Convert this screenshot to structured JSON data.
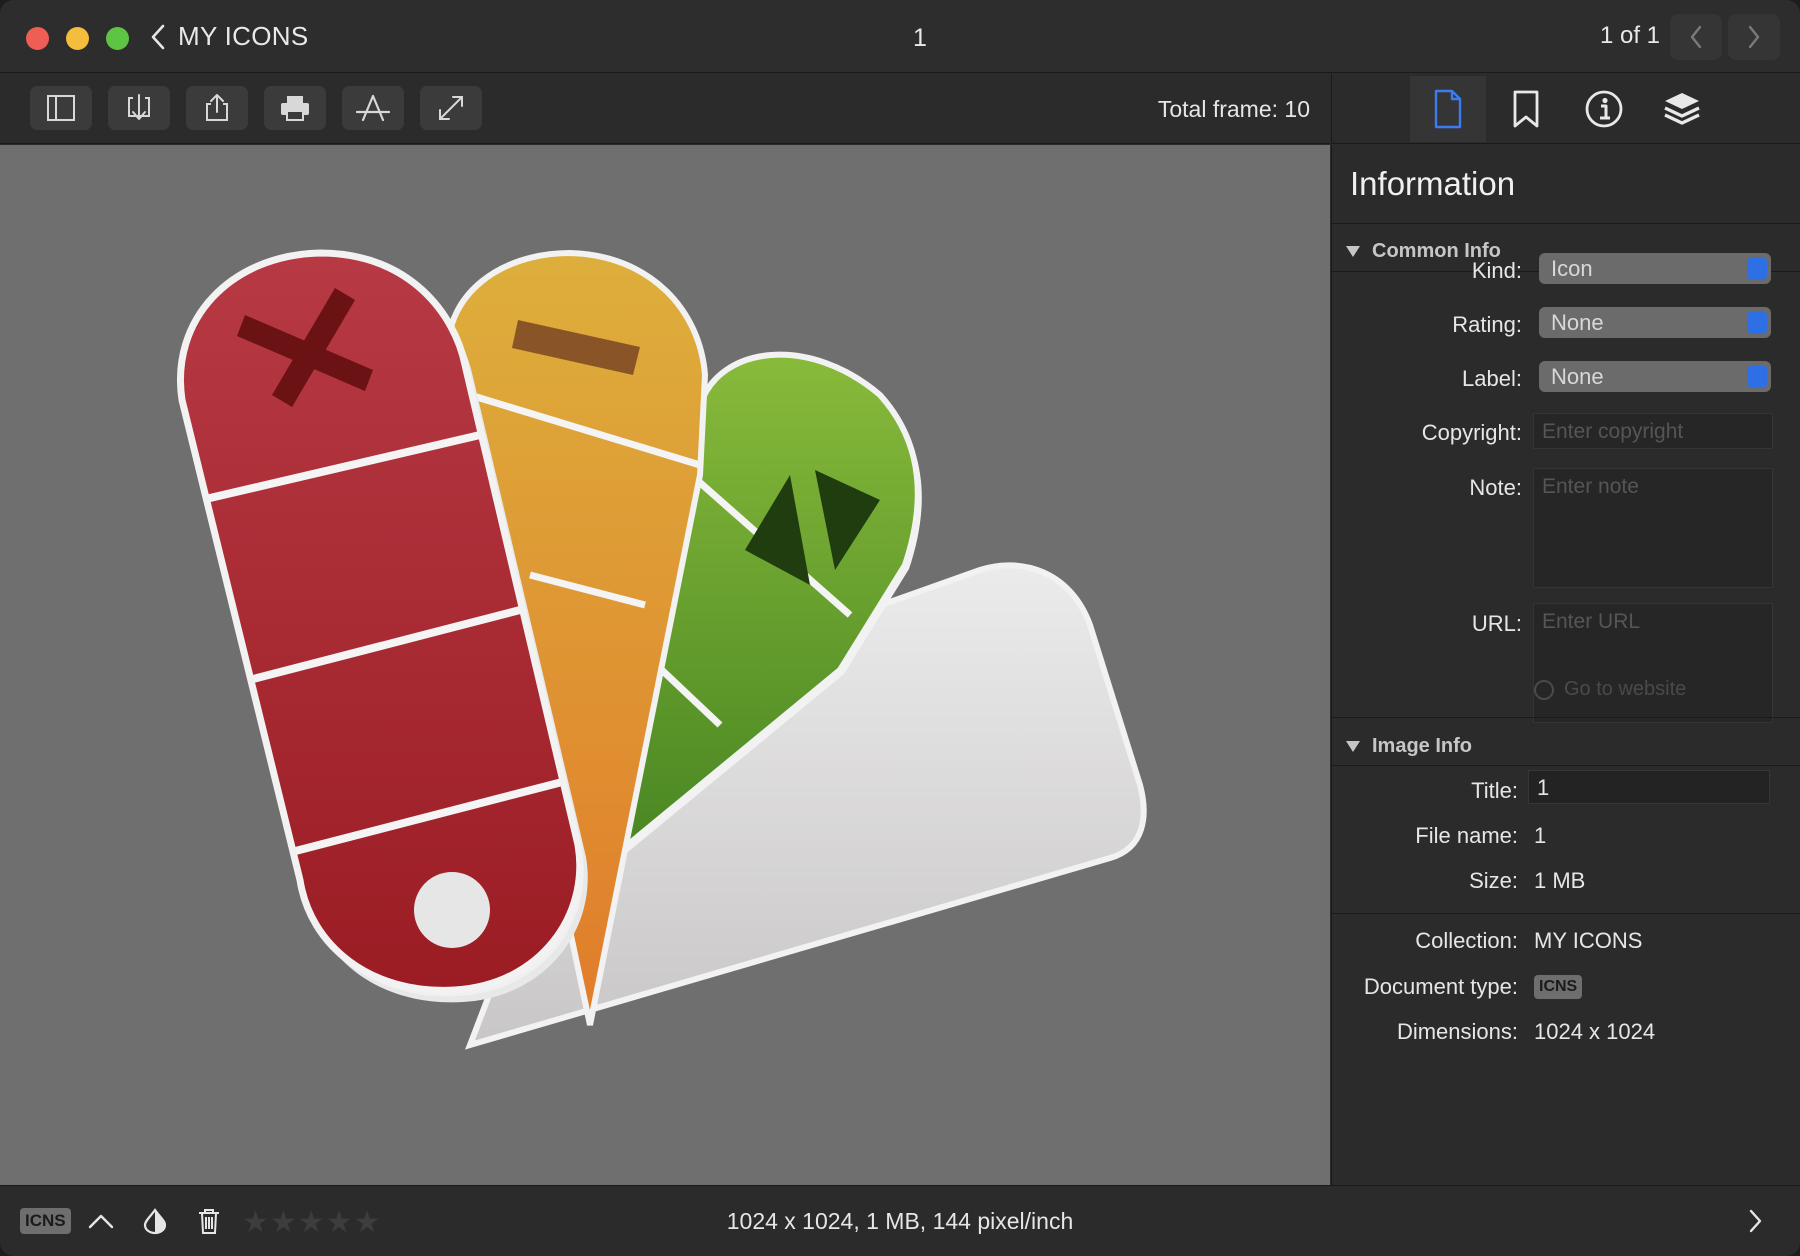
{
  "window": {
    "collection_title": "MY ICONS",
    "document_title": "1",
    "page_counter": "1 of 1"
  },
  "toolbar": {
    "total_frame": "Total frame: 10"
  },
  "inspector": {
    "title": "Information",
    "common_info": {
      "heading": "Common Info",
      "kind_label": "Kind:",
      "kind_value": "Icon",
      "rating_label": "Rating:",
      "rating_value": "None",
      "label_label": "Label:",
      "label_value": "None",
      "copyright_label": "Copyright:",
      "copyright_placeholder": "Enter copyright",
      "note_label": "Note:",
      "note_placeholder": "Enter note",
      "url_label": "URL:",
      "url_placeholder": "Enter URL",
      "go_to_website": "Go to website"
    },
    "image_info": {
      "heading": "Image Info",
      "title_label": "Title:",
      "title_value": "1",
      "file_name_label": "File name:",
      "file_name_value": "1",
      "size_label": "Size:",
      "size_value": "1 MB",
      "collection_label": "Collection:",
      "collection_value": "MY ICONS",
      "document_type_label": "Document type:",
      "document_type_value": "ICNS",
      "dimensions_label": "Dimensions:",
      "dimensions_value": "1024 x 1024"
    }
  },
  "statusbar": {
    "format_badge": "ICNS",
    "summary": "1024 x 1024, 1 MB, 144 pixel/inch",
    "stars": "★★★★★",
    "rating": 0
  },
  "colors": {
    "accent": "#2f6fe5",
    "canvas_bg": "#6f6f6f",
    "swatch_red": "#b0232f",
    "swatch_orange": "#e59a3a",
    "swatch_green": "#5e9b33",
    "swatch_white": "#d9d8d8"
  },
  "icons": {
    "sidebar_toggle": "sidebar-icon",
    "import": "import-icon",
    "share": "share-icon",
    "print": "printer-icon",
    "app_store": "app-store-icon",
    "fullscreen": "fullscreen-icon",
    "tab_document": "document-icon",
    "tab_bookmark": "bookmark-icon",
    "tab_info": "info-icon",
    "tab_layers": "layers-icon"
  }
}
